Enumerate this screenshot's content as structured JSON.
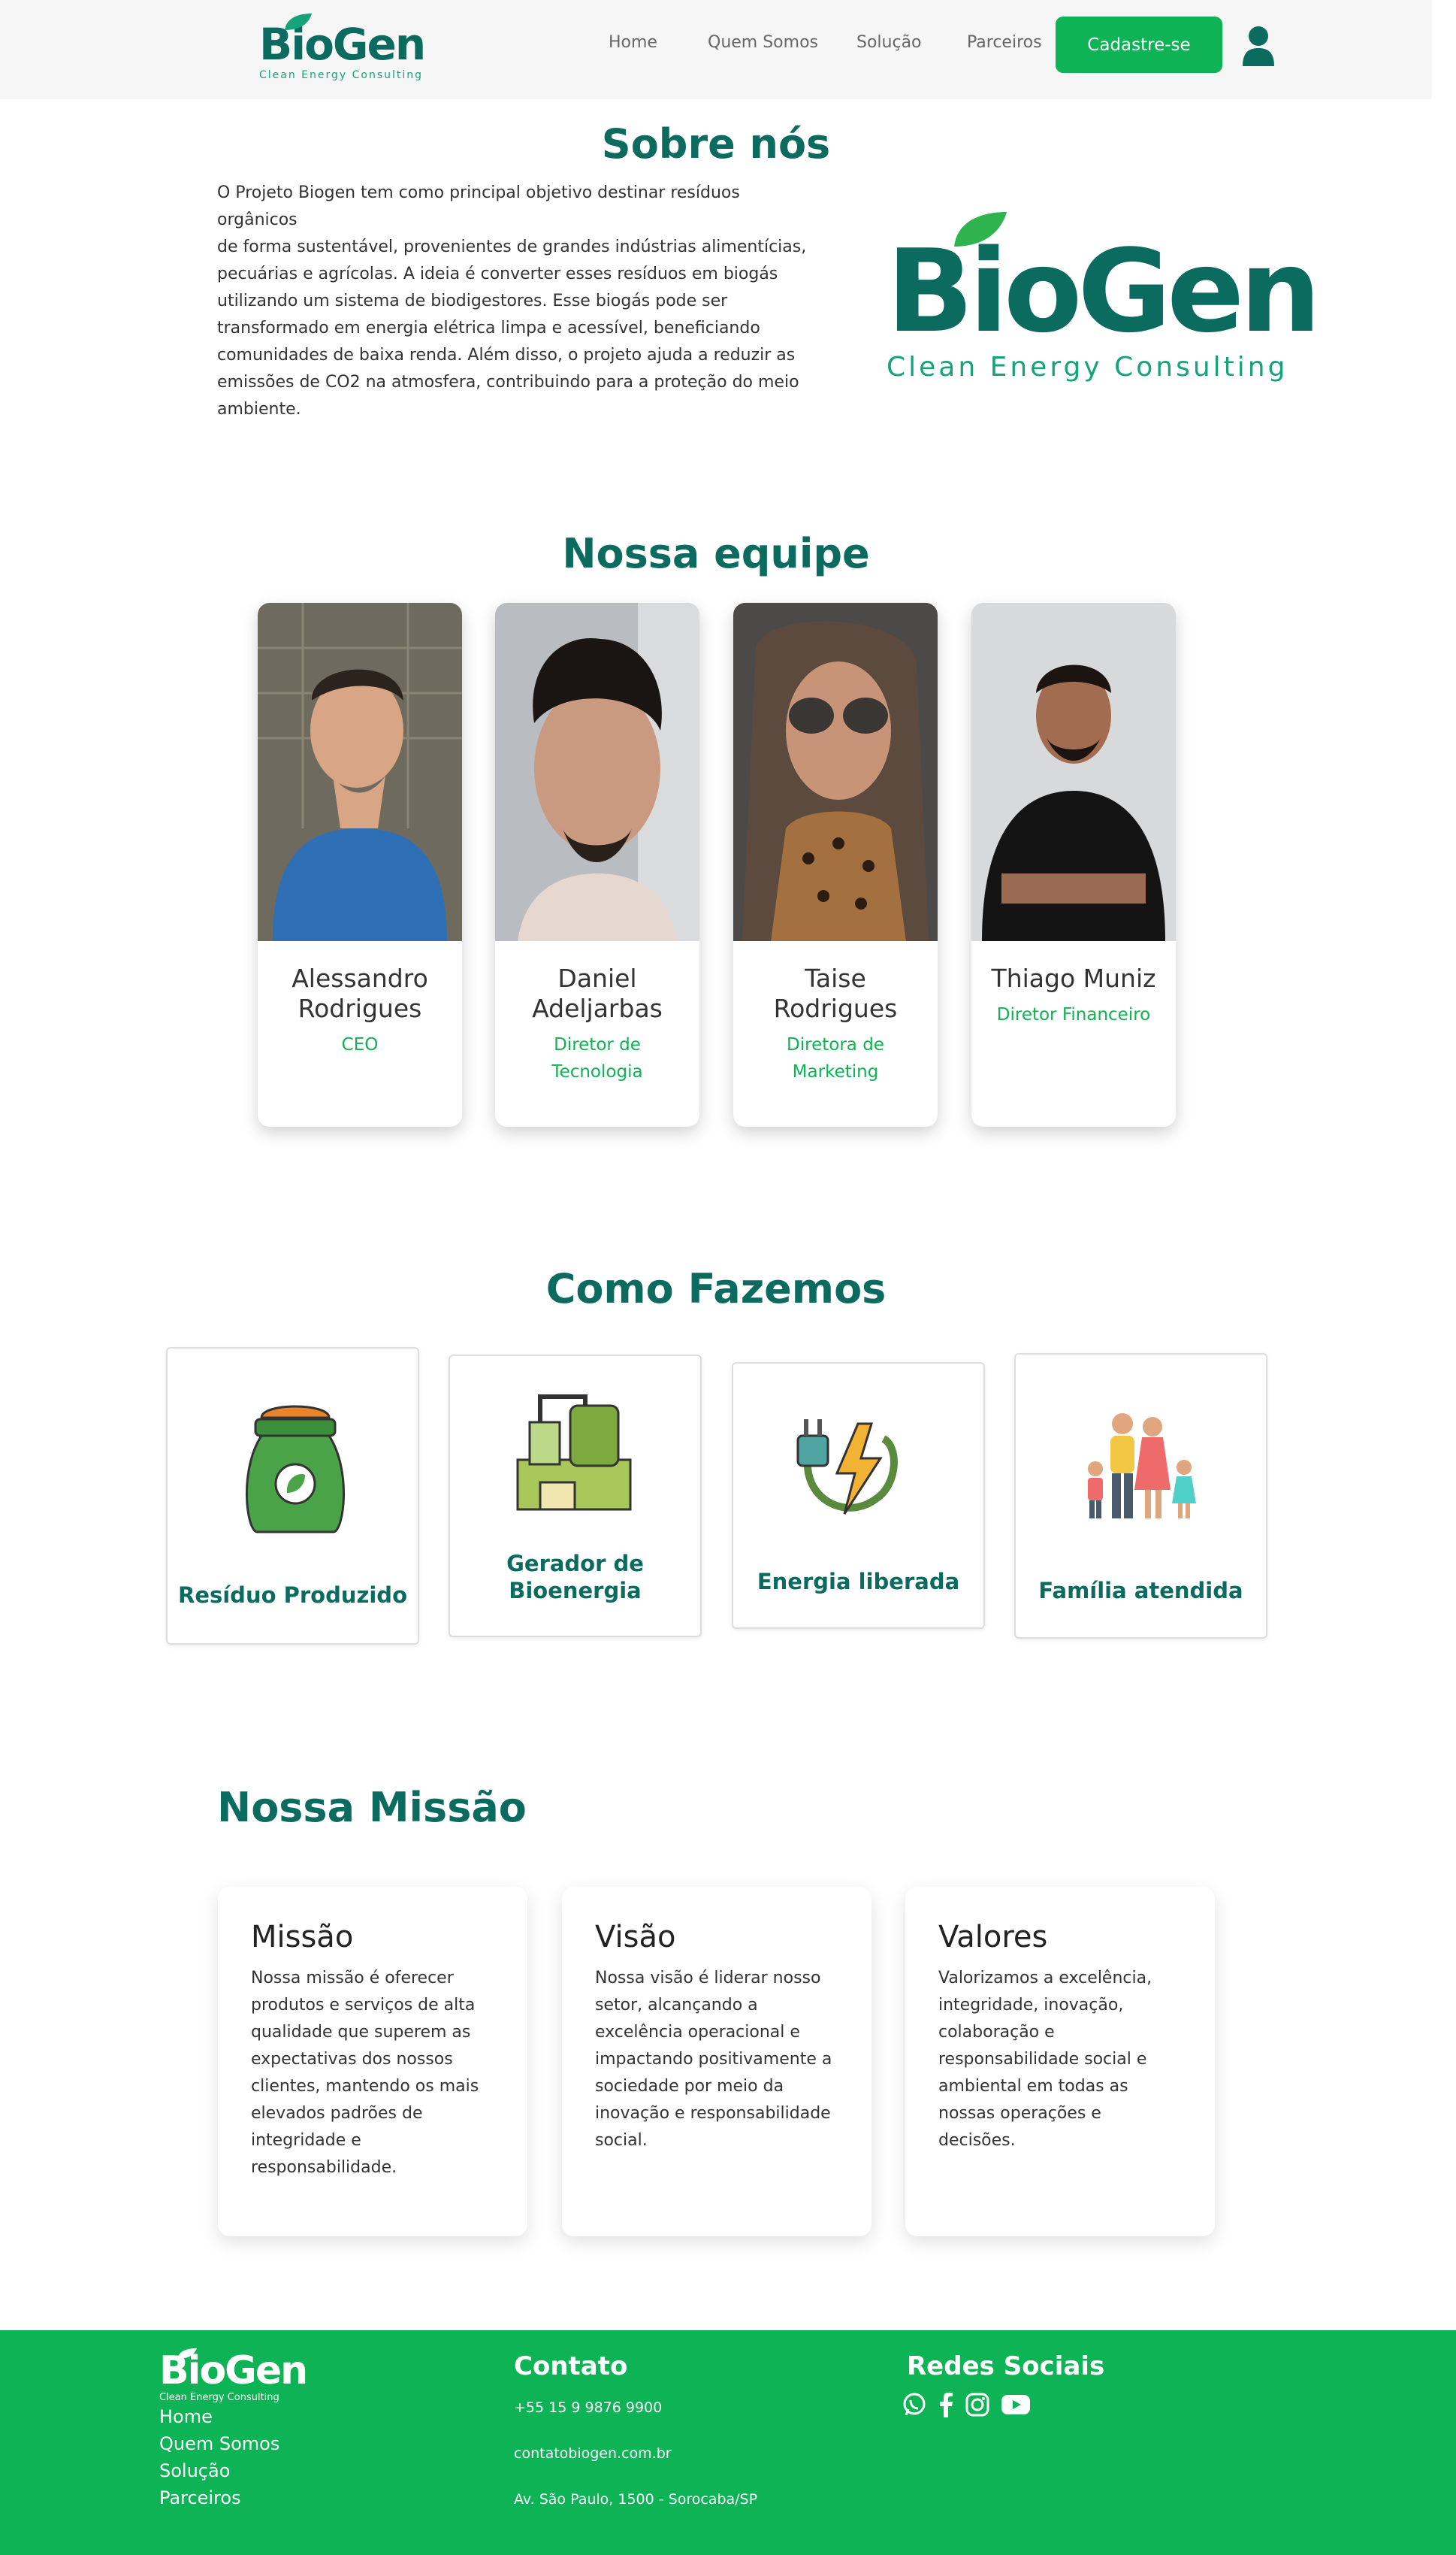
{
  "header": {
    "logo_text": "BioGen",
    "logo_sub": "Clean Energy Consulting",
    "nav": [
      "Home",
      "Quem Somos",
      "Solução",
      "Parceiros"
    ],
    "cta": "Cadastre-se",
    "user_icon": "user-icon"
  },
  "sobre": {
    "title": "Sobre nós",
    "lines": [
      "O Projeto Biogen tem como principal objetivo destinar resíduos orgânicos",
      "de forma sustentável, provenientes de grandes indústrias alimentícias,",
      "pecuárias e agrícolas. A ideia é converter esses resíduos em biogás",
      "utilizando um sistema de biodigestores. Esse biogás pode ser",
      "transformado em energia elétrica limpa e acessível, beneficiando",
      "comunidades de baixa renda. Além disso, o projeto ajuda a reduzir as",
      "emissões de CO2 na atmosfera, contribuindo para a proteção do meio",
      "ambiente."
    ],
    "logo_text": "BioGen",
    "logo_sub": "Clean Energy Consulting"
  },
  "equipe": {
    "title": "Nossa equipe",
    "members": [
      {
        "name": "Alessandro Rodrigues",
        "role": "CEO"
      },
      {
        "name": "Daniel Adeljarbas",
        "role": "Diretor de Tecnologia"
      },
      {
        "name": "Taise Rodrigues",
        "role": "Diretora de Marketing"
      },
      {
        "name": "Thiago Muniz",
        "role": "Diretor Financeiro"
      }
    ]
  },
  "como": {
    "title": "Como Fazemos",
    "items": [
      {
        "label": "Resíduo Produzido",
        "icon": "waste-bag-icon"
      },
      {
        "label": "Gerador de Bioenergia",
        "icon": "bioenergy-plant-icon"
      },
      {
        "label": "Energia liberada",
        "icon": "energy-plug-icon"
      },
      {
        "label": "Família atendida",
        "icon": "family-icon"
      }
    ]
  },
  "missao": {
    "title": "Nossa Missão",
    "cards": [
      {
        "title": "Missão",
        "body": "Nossa missão é oferecer produtos e serviços de alta qualidade que superem as expectativas dos nossos clientes, mantendo os mais elevados padrões de integridade e responsabilidade."
      },
      {
        "title": "Visão",
        "body": "Nossa visão é liderar nosso setor, alcançando a excelência operacional e impactando positivamente a sociedade por meio da inovação e responsabilidade social."
      },
      {
        "title": "Valores",
        "body": "Valorizamos a excelência, integridade, inovação, colaboração e responsabilidade social e ambiental em todas as nossas operações e decisões."
      }
    ]
  },
  "footer": {
    "logo_text": "BioGen",
    "logo_sub": "Clean Energy Consulting",
    "links": [
      "Home",
      "Quem Somos",
      "Solução",
      "Parceiros"
    ],
    "contato_title": "Contato",
    "phone": "+55 15 9 9876 9900",
    "email": "contatobiogen.com.br",
    "address": "Av. São Paulo, 1500 - Sorocaba/SP",
    "redes_title": "Redes Sociais",
    "socials": [
      "whatsapp-icon",
      "facebook-icon",
      "instagram-icon",
      "youtube-icon"
    ]
  },
  "colors": {
    "primary": "#0b6b5f",
    "accent": "#0db354",
    "header_bg": "#f6f6f6"
  }
}
